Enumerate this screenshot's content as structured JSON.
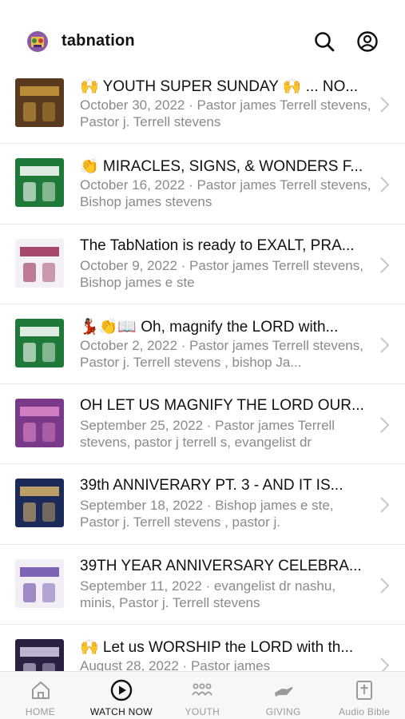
{
  "app": {
    "title": "tabnation"
  },
  "header": {
    "search_icon": "search-icon",
    "account_icon": "account-circle-icon"
  },
  "episodes": [
    {
      "title": "🙌 YOUTH SUPER SUNDAY 🙌 ... NO...",
      "date": "October 30, 2022",
      "speakers": "Pastor james Terrell stevens, Pastor j. Terrell stevens",
      "thumb_colors": [
        "#5a3a1e",
        "#c89a3c"
      ]
    },
    {
      "title": "👏 MIRACLES, SIGNS, & WONDERS F...",
      "date": "October 16, 2022",
      "speakers": "Pastor james Terrell stevens, Bishop james stevens",
      "thumb_colors": [
        "#1f7a3a",
        "#ffffff"
      ]
    },
    {
      "title": "The TabNation is ready to EXALT, PRA...",
      "date": "October 9, 2022",
      "speakers": "Pastor james Terrell stevens, Bishop james e ste",
      "thumb_colors": [
        "#f3f0f6",
        "#9a2a55"
      ]
    },
    {
      "title": "💃🏾👏📖 Oh, magnify the LORD with...",
      "date": "October 2, 2022",
      "speakers": "Pastor james Terrell stevens, Pastor j. Terrell stevens , bishop Ja...",
      "thumb_colors": [
        "#1f7a3a",
        "#ffffff"
      ]
    },
    {
      "title": "OH LET US MAGNIFY THE LORD OUR...",
      "date": "September 25, 2022",
      "speakers": "Pastor james Terrell stevens, pastor j terrell s, evangelist dr",
      "thumb_colors": [
        "#7a3a8a",
        "#e08ac8"
      ]
    },
    {
      "title": "39th ANNIVERARY PT. 3 - AND IT IS...",
      "date": "September 18, 2022",
      "speakers": "Bishop james e ste, Pastor j. Terrell stevens , pastor j.",
      "thumb_colors": [
        "#1c2a5a",
        "#d8b46a"
      ]
    },
    {
      "title": "39TH YEAR ANNIVERSARY CELEBRA...",
      "date": "September 11, 2022",
      "speakers": "evangelist dr nashu, minis, Pastor j. Terrell stevens",
      "thumb_colors": [
        "#f2eef6",
        "#6a4aa8"
      ]
    },
    {
      "title": "🙌 Let us WORSHIP the LORD with th...",
      "date": "August 28, 2022",
      "speakers": "Pastor james",
      "thumb_colors": [
        "#2a2040",
        "#d8d0e8"
      ]
    }
  ],
  "separator": " · ",
  "tabs": [
    {
      "label": "HOME",
      "icon": "home-icon",
      "active": false
    },
    {
      "label": "WATCH NOW",
      "icon": "play-circle-icon",
      "active": true
    },
    {
      "label": "YOUTH",
      "icon": "people-group-icon",
      "active": false
    },
    {
      "label": "GIVING",
      "icon": "giving-hand-icon",
      "active": false
    },
    {
      "label": "Audio Bible",
      "icon": "bible-icon",
      "active": false
    }
  ]
}
